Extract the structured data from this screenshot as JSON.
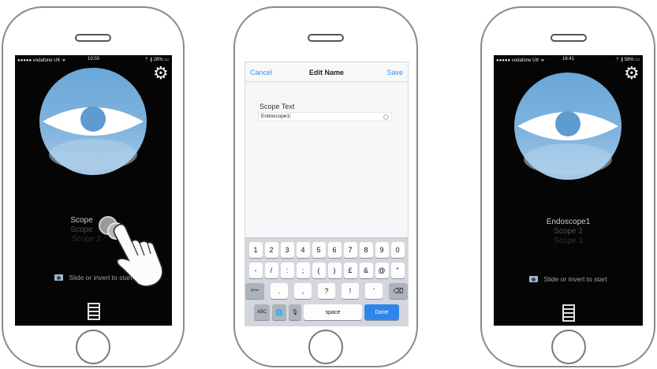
{
  "colors": {
    "accent_blue": "#3a8ee6",
    "logo_blue": "#7fb3dd",
    "screen_bg": "#050505",
    "done_key": "#2f86e8"
  },
  "phone1": {
    "status": {
      "carrier": "●●●●● vodafone UK ᯤ",
      "time": "10:03",
      "battery": "⇡ ∦ 28% ▭"
    },
    "settings_icon": "gear-icon",
    "scopes": [
      "Scope",
      "Scope",
      "Scope 3"
    ],
    "slide_text": "Slide or invert to start",
    "gesture_icon": "tap-hand-icon"
  },
  "phone2": {
    "nav": {
      "cancel": "Cancel",
      "title": "Edit Name",
      "save": "Save"
    },
    "field_label": "Scope Text",
    "field_value": "Endoscope1",
    "keyboard": {
      "row1": [
        "1",
        "2",
        "3",
        "4",
        "5",
        "6",
        "7",
        "8",
        "9",
        "0"
      ],
      "row2": [
        "-",
        "/",
        ":",
        ";",
        "(",
        ")",
        "£",
        "&",
        "@",
        "\""
      ],
      "row3_left": "#+=",
      "row3": [
        ".",
        ",",
        "?",
        "!",
        "'"
      ],
      "row3_right": "⌫",
      "row4_abc": "ABC",
      "row4_globe": "🌐",
      "row4_mic": "🎙",
      "space": "space",
      "done": "Done"
    }
  },
  "phone3": {
    "status": {
      "carrier": "●●●●● vodafone UK ᯤ",
      "time": "16:41",
      "battery": "⇡ ∦ 58% ▭"
    },
    "settings_icon": "gear-icon",
    "scopes": [
      "Endoscope1",
      "Scope 2",
      "Scope 3"
    ],
    "slide_text": "Slide or invert to start"
  }
}
